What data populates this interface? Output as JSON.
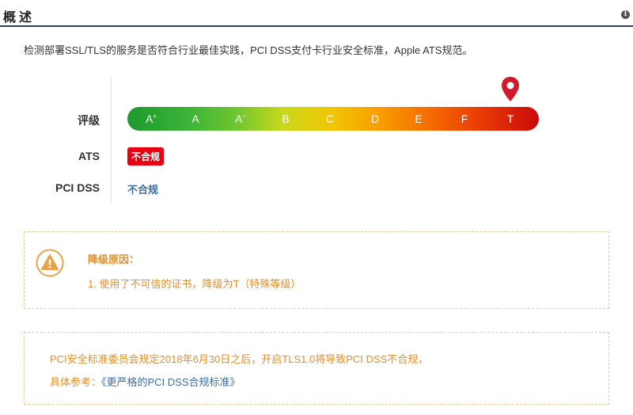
{
  "header": {
    "title": "概述",
    "info_icon": "info-icon"
  },
  "description": "检测部署SSL/TLS的服务是否符合行业最佳实践，PCI DSS支付卡行业安全标准，Apple ATS规范。",
  "rating": {
    "label": "评级",
    "grades": [
      "A+",
      "A",
      "A-",
      "B",
      "C",
      "D",
      "E",
      "F",
      "T"
    ],
    "current": "T",
    "marker_icon": "map-pin-icon"
  },
  "ats": {
    "label": "ATS",
    "status": "不合规",
    "status_color": "#e60012"
  },
  "pci": {
    "label": "PCI DSS",
    "status": "不合规",
    "status_color": "#3a6ea5"
  },
  "downgrade": {
    "icon": "warning-icon",
    "title": "降级原因：",
    "items": [
      "1. 使用了不可信的证书，降级为T（特殊等级）"
    ]
  },
  "notice": {
    "text": "PCI安全标准委员会规定2018年6月30日之后，开启TLS1.0将导致PCI DSS不合规，",
    "ref_label": "具体参考：",
    "ref_link": "《更严格的PCI DSS合规标准》"
  },
  "colors": {
    "accent_orange": "#e08f2f",
    "link_blue": "#3a6ea5",
    "alert_red": "#e60012",
    "header_rule": "#2c3e5c"
  }
}
